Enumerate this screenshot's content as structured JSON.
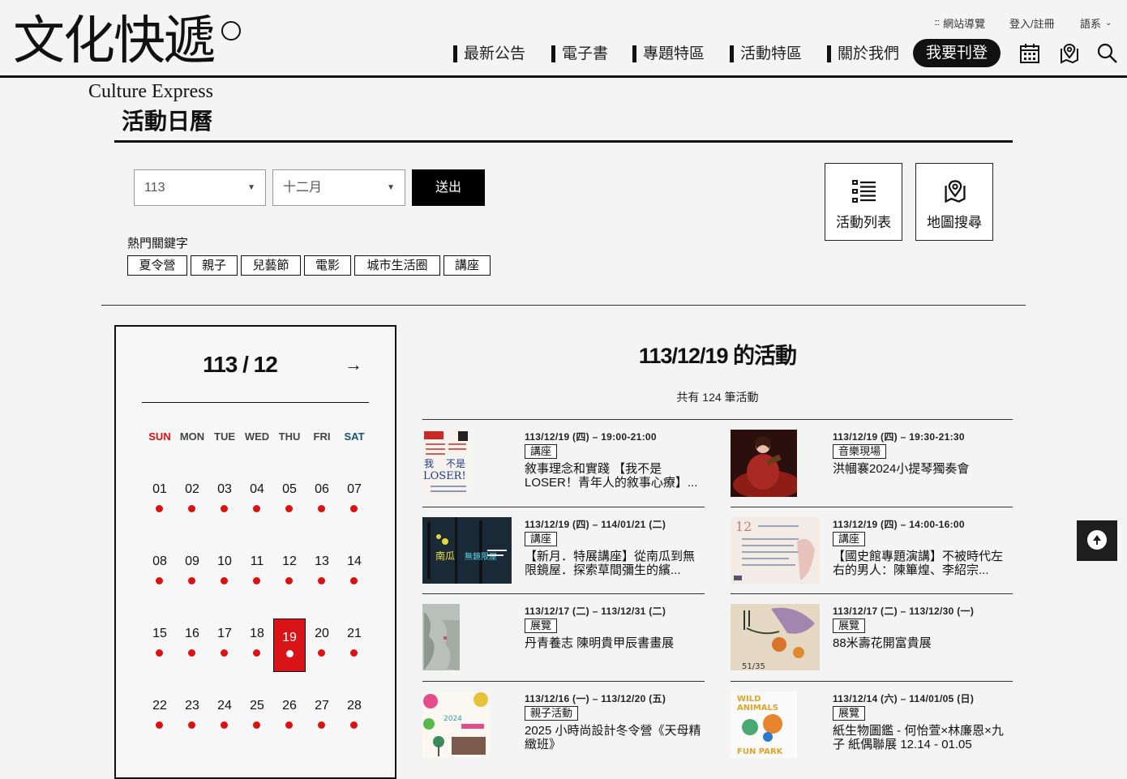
{
  "header": {
    "logo_cn": "文化快遞",
    "logo_en": "Culture Express",
    "utility": {
      "sitemap": "網站導覽",
      "login": "登入/註冊",
      "language": "語系"
    },
    "nav": [
      "最新公告",
      "電子書",
      "專題特區",
      "活動特區",
      "關於我們"
    ],
    "publish_label": "我要刊登",
    "icons": [
      "calendar-icon",
      "map-pin-icon",
      "search-icon"
    ]
  },
  "page": {
    "title": "活動日曆",
    "year_select": "113",
    "month_select": "十二月",
    "submit_label": "送出",
    "list_button": "活動列表",
    "map_button": "地圖搜尋",
    "hot_label": "熱門關鍵字",
    "hot_tags": [
      "夏令營",
      "親子",
      "兒藝節",
      "電影",
      "城市生活圈",
      "講座"
    ]
  },
  "calendar": {
    "month_label": "113 / 12",
    "weekdays": [
      "SUN",
      "MON",
      "TUE",
      "WED",
      "THU",
      "FRI",
      "SAT"
    ],
    "days": [
      "01",
      "02",
      "03",
      "04",
      "05",
      "06",
      "07",
      "08",
      "09",
      "10",
      "11",
      "12",
      "13",
      "14",
      "15",
      "16",
      "17",
      "18",
      "19",
      "20",
      "21",
      "22",
      "23",
      "24",
      "25",
      "26",
      "27",
      "28"
    ],
    "selected_day": "19",
    "accent_color": "#d81419"
  },
  "activities": {
    "heading": "113/12/19 的活動",
    "count_text": "共有 124 筆活動",
    "events": [
      {
        "date": "113/12/19 (四) – 19:00-21:00",
        "category": "講座",
        "title": "敘事理念和實踐 【我不是LOSER！青年人的敘事心療】..."
      },
      {
        "date": "113/12/19 (四) – 19:30-21:30",
        "category": "音樂現場",
        "title": "洪幗褰2024小提琴獨奏會"
      },
      {
        "date": "113/12/19 (四) – 114/01/21 (二)",
        "category": "講座",
        "title": "【新月．特展講座】從南瓜到無限鏡屋．探索草間彌生的繽..."
      },
      {
        "date": "113/12/19 (四) – 14:00-16:00",
        "category": "講座",
        "title": "【國史館專題演講】不被時代左右的男人：陳篳煌、李紹宗..."
      },
      {
        "date": "113/12/17 (二) – 113/12/31 (二)",
        "category": "展覽",
        "title": "丹青養志 陳明貴甲辰書畫展"
      },
      {
        "date": "113/12/17 (二) – 113/12/30 (一)",
        "category": "展覽",
        "title": "88米壽花開富貴展"
      },
      {
        "date": "113/12/16 (一) – 113/12/20 (五)",
        "category": "親子活動",
        "title": "2025 小時尚設計冬令營《天母精緻班》"
      },
      {
        "date": "113/12/14 (六) – 114/01/05 (日)",
        "category": "展覽",
        "title": "紙生物圖鑑 - 何怡萱×林廉恩×九子 紙偶聯展 12.14 - 01.05"
      }
    ],
    "thumb_text": {
      "loser_a": "我",
      "loser_b": "不是",
      "loser_c": "LOSER!",
      "pumpkin": "南瓜",
      "pumpkin_b": "無鏡限屋",
      "archive": "12",
      "page": "51/35",
      "summer": "2024",
      "wild": "WILD",
      "animals": "ANIMALS",
      "funpark": "FUN PARK"
    }
  }
}
